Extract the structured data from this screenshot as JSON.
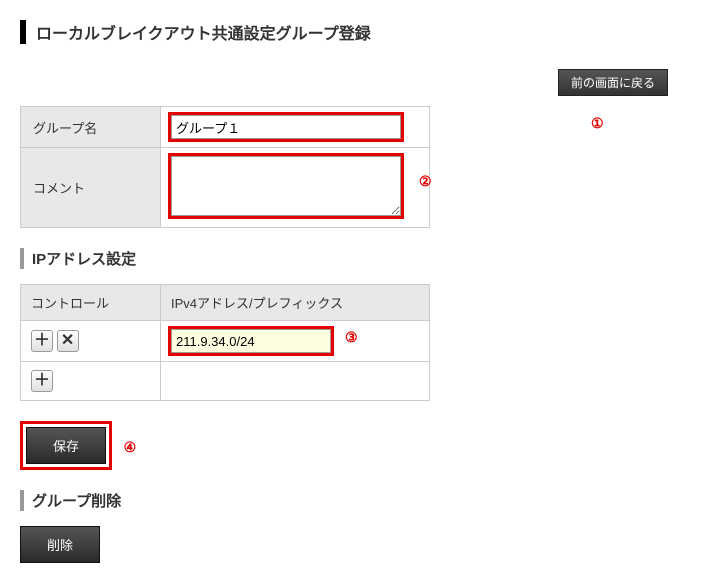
{
  "page": {
    "title": "ローカルブレイクアウト共通設定グループ登録"
  },
  "buttons": {
    "back": "前の画面に戻る",
    "save": "保存",
    "delete": "削除"
  },
  "labels": {
    "group_name": "グループ名",
    "comment": "コメント",
    "ip_section": "IPアドレス設定",
    "delete_section": "グループ削除",
    "control_col": "コントロール",
    "ipv4_col": "IPv4アドレス/プレフィックス"
  },
  "form": {
    "group_name_value": "グループ１",
    "comment_value": ""
  },
  "ip_rows": [
    {
      "value": "211.9.34.0/24"
    }
  ],
  "markers": {
    "m1": "①",
    "m2": "②",
    "m3": "③",
    "m4": "④"
  },
  "icons": {
    "plus": "＋",
    "close": "✕"
  }
}
